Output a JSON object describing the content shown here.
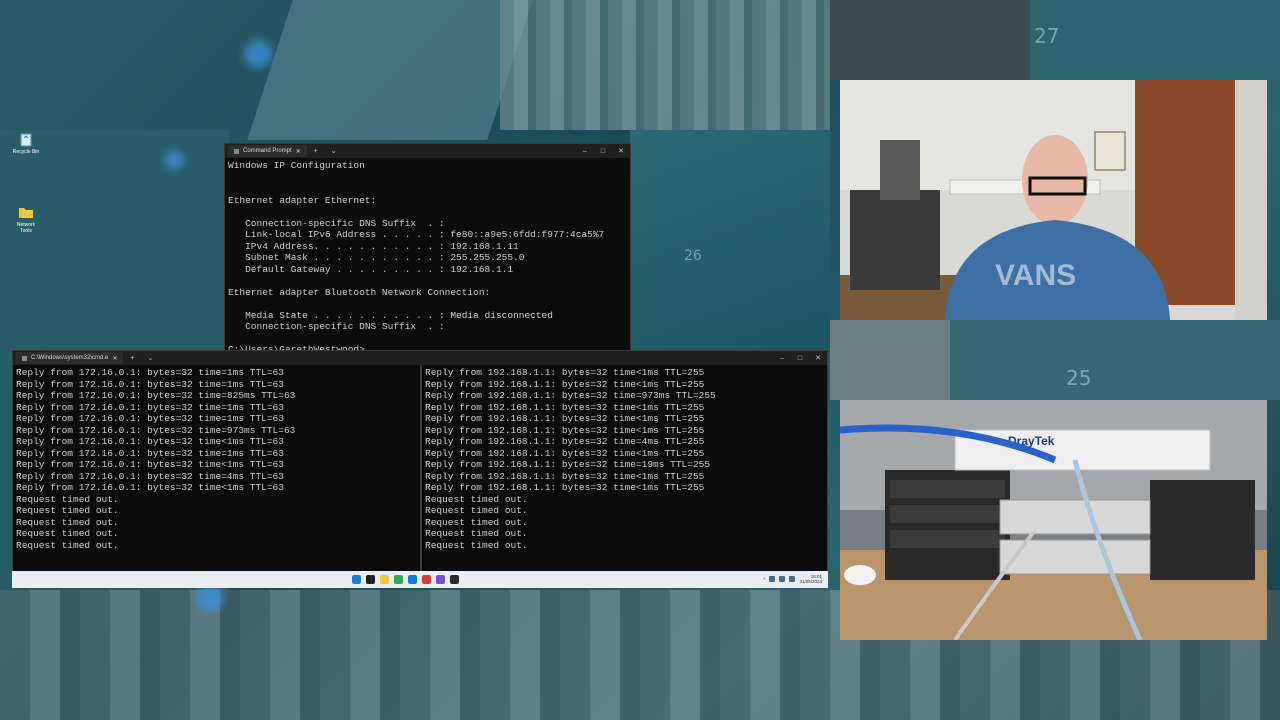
{
  "desktop": {
    "icons": [
      {
        "label": "Recycle Bin",
        "icon": "recycle-bin-icon"
      },
      {
        "label": "Network Tools",
        "icon": "folder-icon"
      }
    ],
    "decor_numbers": [
      "27",
      "26",
      "25"
    ]
  },
  "ipconfig_window": {
    "title": "Command Prompt",
    "lines": [
      "Windows IP Configuration",
      "",
      "",
      "Ethernet adapter Ethernet:",
      "",
      "   Connection-specific DNS Suffix  . :",
      "   Link-local IPv6 Address . . . . . : fe80::a9e5:6fdd:f977:4ca5%7",
      "   IPv4 Address. . . . . . . . . . . : 192.168.1.11",
      "   Subnet Mask . . . . . . . . . . . : 255.255.255.0",
      "   Default Gateway . . . . . . . . . : 192.168.1.1",
      "",
      "Ethernet adapter Bluetooth Network Connection:",
      "",
      "   Media State . . . . . . . . . . . : Media disconnected",
      "   Connection-specific DNS Suffix  . :",
      "",
      "C:\\Users\\GarethWestwood>"
    ]
  },
  "ping_window": {
    "title": "C:\\Windows\\system32\\cmd.e",
    "left_lines": [
      "Reply from 172.16.0.1: bytes=32 time=1ms TTL=63",
      "Reply from 172.16.0.1: bytes=32 time=1ms TTL=63",
      "Reply from 172.16.0.1: bytes=32 time=825ms TTL=63",
      "Reply from 172.16.0.1: bytes=32 time=1ms TTL=63",
      "Reply from 172.16.0.1: bytes=32 time=1ms TTL=63",
      "Reply from 172.16.0.1: bytes=32 time=973ms TTL=63",
      "Reply from 172.16.0.1: bytes=32 time<1ms TTL=63",
      "Reply from 172.16.0.1: bytes=32 time=1ms TTL=63",
      "Reply from 172.16.0.1: bytes=32 time<1ms TTL=63",
      "Reply from 172.16.0.1: bytes=32 time=4ms TTL=63",
      "Reply from 172.16.0.1: bytes=32 time<1ms TTL=63",
      "Request timed out.",
      "Request timed out.",
      "Request timed out.",
      "Request timed out.",
      "Request timed out."
    ],
    "right_lines": [
      "Reply from 192.168.1.1: bytes=32 time<1ms TTL=255",
      "Reply from 192.168.1.1: bytes=32 time<1ms TTL=255",
      "Reply from 192.168.1.1: bytes=32 time=973ms TTL=255",
      "Reply from 192.168.1.1: bytes=32 time<1ms TTL=255",
      "Reply from 192.168.1.1: bytes=32 time<1ms TTL=255",
      "Reply from 192.168.1.1: bytes=32 time<1ms TTL=255",
      "Reply from 192.168.1.1: bytes=32 time=4ms TTL=255",
      "Reply from 192.168.1.1: bytes=32 time<1ms TTL=255",
      "Reply from 192.168.1.1: bytes=32 time=19ms TTL=255",
      "Reply from 192.168.1.1: bytes=32 time<1ms TTL=255",
      "Reply from 192.168.1.1: bytes=32 time<1ms TTL=255",
      "Request timed out.",
      "Request timed out.",
      "Request timed out.",
      "Request timed out.",
      "Request timed out."
    ]
  },
  "taskbar": {
    "apps": [
      {
        "icon": "windows-start-icon",
        "color": "#1a7fd4"
      },
      {
        "icon": "file-explorer-icon",
        "color": "#222222"
      },
      {
        "icon": "folder-icon",
        "color": "#f4c542"
      },
      {
        "icon": "chrome-icon",
        "color": "#34a853"
      },
      {
        "icon": "edge-icon",
        "color": "#0f7bd4"
      },
      {
        "icon": "app-icon",
        "color": "#d93a3a"
      },
      {
        "icon": "camera-app-icon",
        "color": "#7a4fd0"
      },
      {
        "icon": "terminal-icon",
        "color": "#2b2b2b"
      }
    ],
    "clock_time": "16:01",
    "clock_date": "31/05/2024"
  },
  "colors": {
    "console_bg": "#0c0c0c",
    "console_text": "#cccccc",
    "accent": "#1a7fd4"
  }
}
